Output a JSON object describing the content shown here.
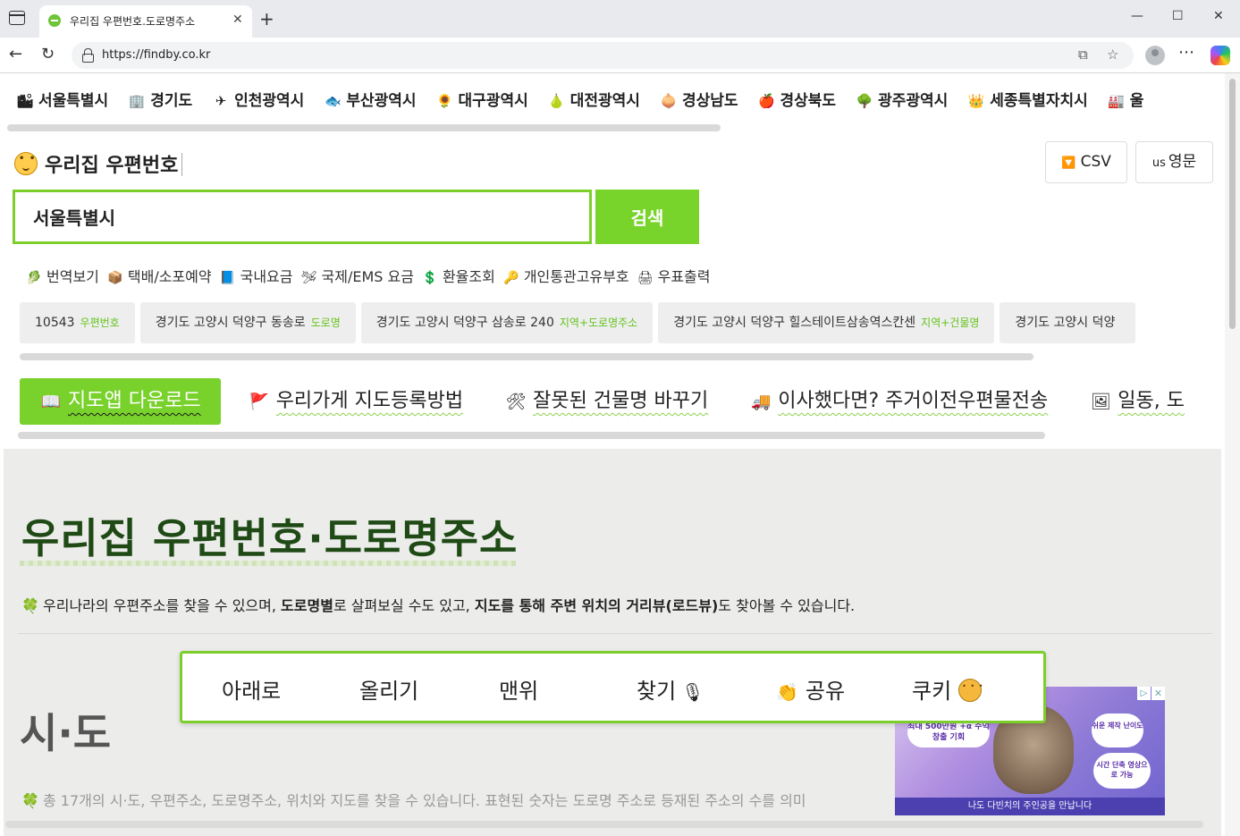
{
  "browser": {
    "tab_title": "우리집 우편번호.도로명주소",
    "tab_close": "✕",
    "new_tab": "+",
    "url": "https://findby.co.kr",
    "win_min": "—",
    "win_max": "☐",
    "win_close": "✕",
    "back": "←",
    "reload": "↻",
    "split_icon": "⧉",
    "star_icon": "☆",
    "more_icon": "⋯"
  },
  "regions": [
    {
      "icon": "🏙",
      "label": "서울특별시"
    },
    {
      "icon": "🏢",
      "label": "경기도"
    },
    {
      "icon": "✈",
      "label": "인천광역시"
    },
    {
      "icon": "🐟",
      "label": "부산광역시"
    },
    {
      "icon": "🌻",
      "label": "대구광역시"
    },
    {
      "icon": "🍐",
      "label": "대전광역시"
    },
    {
      "icon": "🧅",
      "label": "경상남도"
    },
    {
      "icon": "🍎",
      "label": "경상북도"
    },
    {
      "icon": "🌳",
      "label": "광주광역시"
    },
    {
      "icon": "👑",
      "label": "세종특별자치시"
    },
    {
      "icon": "🏭",
      "label": "울"
    }
  ],
  "header": {
    "title": "우리집 우편번호",
    "csv_icon": "🔽",
    "csv_label": "CSV",
    "en_prefix": "us",
    "en_label": "영문"
  },
  "search": {
    "value": "서울특별시",
    "button": "검색"
  },
  "quick_links": [
    {
      "icon": "🥬",
      "label": "번역보기"
    },
    {
      "icon": "📦",
      "label": "택배/소포예약"
    },
    {
      "icon": "📘",
      "label": "국내요금"
    },
    {
      "icon": "🛩",
      "label": "국제/EMS 요금"
    },
    {
      "icon": "💲",
      "label": "환율조회"
    },
    {
      "icon": "🔑",
      "label": "개인통관고유부호"
    },
    {
      "icon": "🖨",
      "label": "우표출력"
    }
  ],
  "results": [
    {
      "text": "10543",
      "tag": "우편번호"
    },
    {
      "text": "경기도 고양시 덕양구 동송로",
      "tag": "도로명"
    },
    {
      "text": "경기도 고양시 덕양구 삼송로 240",
      "tag": "지역+도로명주소"
    },
    {
      "text": "경기도 고양시 덕양구 힐스테이트삼송역스칸센",
      "tag": "지역+건물명"
    },
    {
      "text": "경기도 고양시 덕양",
      "tag": ""
    }
  ],
  "guides": [
    {
      "icon": "📖",
      "label": "지도앱 다운로드",
      "active": true
    },
    {
      "icon": "🚩",
      "label": "우리가게 지도등록방법"
    },
    {
      "icon": "🛠",
      "label": "잘못된 건물명 바꾸기"
    },
    {
      "icon": "🚚",
      "label": "이사했다면? 주거이전우편물전송"
    },
    {
      "icon": "🖼",
      "label": "일동, 도"
    }
  ],
  "hero": {
    "title": "우리집 우편번호·도로명주소",
    "desc_icon": "🍀",
    "desc_1": "우리나라의 우편주소를 찾을 수 있으며, ",
    "desc_2": "도로명별",
    "desc_3": "로 살펴보실 수도 있고, ",
    "desc_4": "지도를 통해 주변 위치의 거리뷰(로드뷰)",
    "desc_5": "도 찾아볼 수 있습니다.",
    "sido_title": "시·도",
    "sido_desc": "총 17개의 시·도, 우편주소, 도로명주소, 위치와 지도를 찾을 수 있습니다. 표현된 숫자는 도로명 주소로 등재된 주소의 수를 의미"
  },
  "ad": {
    "bubble_1": "최대 500만원 +α 수익 창출 기회",
    "bubble_2": "쉬운 제작 난이도",
    "bubble_3": "시간 단축 영상으로 가능",
    "bottom": "나도 다빈치의 주인공을 만납니다",
    "close": "✕",
    "info": "▷"
  },
  "float_bar": {
    "down": "아래로",
    "up": "올리기",
    "top": "맨위",
    "find": "찾기",
    "find_icon": "🎙",
    "share_icon": "👏",
    "share": "공유",
    "cookie": "쿠키"
  }
}
